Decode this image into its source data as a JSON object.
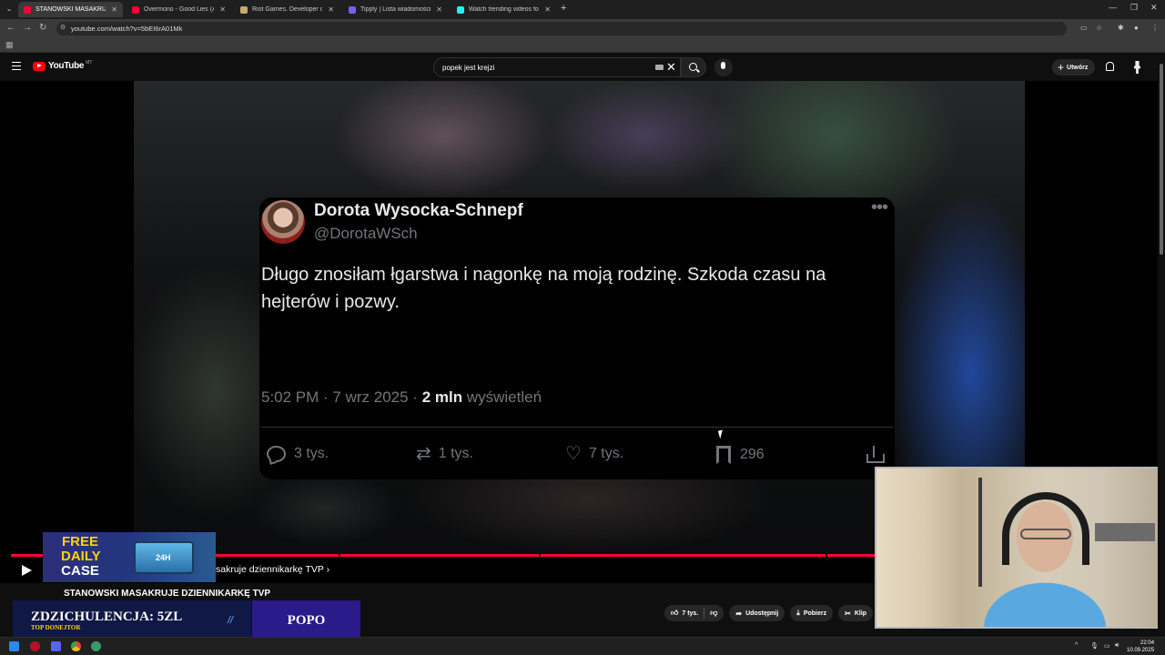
{
  "browser": {
    "tabs": [
      {
        "label": "STANOWSKI MASAKRUJE DZIE...",
        "color": "#ff0033",
        "active": true
      },
      {
        "label": "Overmono - Good Lies (Audio)",
        "color": "#ff0033",
        "active": false
      },
      {
        "label": "Riot Games. Developer of Leag",
        "color": "#c8aa6e",
        "active": false
      },
      {
        "label": "Tipply | Lista wiadomości",
        "color": "#7a5cff",
        "active": false
      },
      {
        "label": "Watch trending videos for you",
        "color": "#25f4ee",
        "active": false
      }
    ],
    "url": "youtube.com/watch?v=5bEI6rA01Mk"
  },
  "youtube": {
    "logo_text": "YouTube",
    "logo_cc": "MT",
    "search_value": "popek jest krejzi",
    "create_label": "Utwórz"
  },
  "tweet": {
    "name": "Dorota Wysocka-Schnepf",
    "handle": "@DorotaWSch",
    "text": "Długo znosiłam łgarstwa i nagonkę na moją rodzinę. Szkoda czasu na hejterów i pozwy.",
    "time": "5:02 PM · 7 wrz 2025 ·",
    "views_count": "2 mln",
    "views_label": "wyświetleń",
    "replies": "3 tys.",
    "retweets": "1 tys.",
    "likes": "7 tys.",
    "bookmarks": "296"
  },
  "player": {
    "chapter": "sakruje dziennikarkę TVP ›",
    "progress": 1.0
  },
  "overlays": {
    "ad_line1": "FREE",
    "ad_line2": "DAILY",
    "ad_line3": "CASE",
    "ad_box": "24H",
    "donate_main": "ZDZICHULENCJA: 5ZL",
    "donate_sub": "TOP DONEJTOR",
    "popo": "POPO"
  },
  "video": {
    "title": "STANOWSKI MASAKRUJE DZIENNIKARKĘ TVP",
    "likes": "7 tys.",
    "share_label": "Udostępnij",
    "download_label": "Pobierz",
    "clip_label": "Klip"
  },
  "taskbar": {
    "time": "22:04",
    "date": "10.09.2025"
  }
}
